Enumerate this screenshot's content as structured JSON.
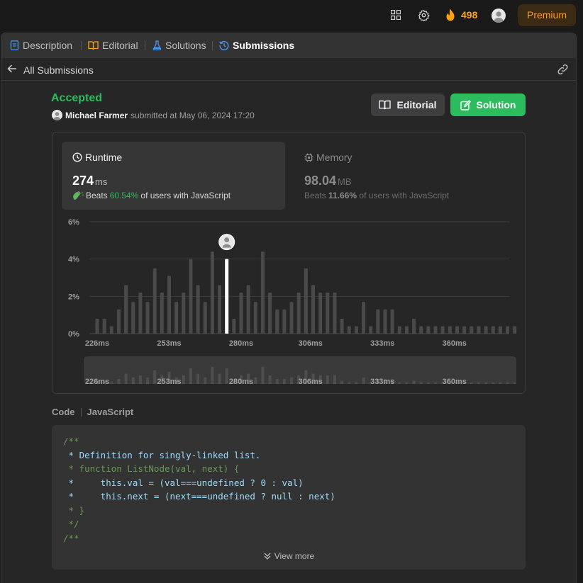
{
  "topnav": {
    "streak_count": "498",
    "premium_label": "Premium",
    "accent": "#ffa116"
  },
  "tabs": [
    {
      "label": "Description",
      "icon": "description-icon"
    },
    {
      "label": "Editorial",
      "icon": "book-icon"
    },
    {
      "label": "Solutions",
      "icon": "flask-icon"
    },
    {
      "label": "Submissions",
      "icon": "history-icon",
      "active": true
    }
  ],
  "subbar": {
    "title": "All Submissions"
  },
  "submission": {
    "status": "Accepted",
    "status_color": "#2cbb5d",
    "user": "Michael Farmer",
    "submitted_text": "submitted at May 06, 2024 17:20"
  },
  "buttons": {
    "editorial": "Editorial",
    "solution": "Solution"
  },
  "runtime": {
    "label": "Runtime",
    "value": "274",
    "unit": "ms",
    "beats_prefix": "Beats",
    "beats_pct": "60.54%",
    "beats_suffix": "of users with JavaScript"
  },
  "memory": {
    "label": "Memory",
    "value": "98.04",
    "unit": "MB",
    "beats_prefix": "Beats",
    "beats_pct": "11.66%",
    "beats_suffix": "of users with JavaScript"
  },
  "chart_data": {
    "type": "bar",
    "ylim": [
      0,
      6
    ],
    "yticks": [
      "6%",
      "4%",
      "2%",
      "0%"
    ],
    "ytick_values": [
      6,
      4,
      2,
      0
    ],
    "xticks": [
      "226ms",
      "253ms",
      "280ms",
      "306ms",
      "333ms",
      "360ms"
    ],
    "xtick_values": [
      226,
      253,
      280,
      306,
      333,
      360
    ],
    "x_start": 226,
    "x_step": 2.7,
    "highlight_index": 18,
    "grid": true,
    "values": [
      0.8,
      0.8,
      0.4,
      1.3,
      2.6,
      1.7,
      2.2,
      1.7,
      3.5,
      2.2,
      3.1,
      1.7,
      2.2,
      4.0,
      2.6,
      1.7,
      4.4,
      2.6,
      4.0,
      0.8,
      2.2,
      2.6,
      1.7,
      4.4,
      2.2,
      1.3,
      1.3,
      1.7,
      2.2,
      3.5,
      2.6,
      2.2,
      2.2,
      2.2,
      0.8,
      0.4,
      0.4,
      1.7,
      0.4,
      1.3,
      1.3,
      1.3,
      0.4,
      0.4,
      0.8,
      0.4,
      0.4,
      0.4,
      0.4,
      0.4,
      0.4,
      0.4,
      0.4,
      0.4,
      0.4,
      0.4,
      0.4,
      0.4,
      0.4
    ],
    "bar_color": "#4a4a4a",
    "highlight_color": "#ffffff"
  },
  "code": {
    "header": "Code",
    "language": "JavaScript",
    "lines": [
      {
        "text": "/**",
        "cls": "c-green"
      },
      {
        "text": " * Definition for singly-linked list.",
        "cls": "c-blue"
      },
      {
        "text": " * function ListNode(val, next) {",
        "cls": "c-green"
      },
      {
        "text": " *     this.val = (val===undefined ? 0 : val)",
        "cls": "c-blue"
      },
      {
        "text": " *     this.next = (next===undefined ? null : next)",
        "cls": "c-blue"
      },
      {
        "text": " * }",
        "cls": "c-green"
      },
      {
        "text": " */",
        "cls": "c-green"
      },
      {
        "text": "/**",
        "cls": "c-green"
      }
    ],
    "view_more": "View more"
  }
}
